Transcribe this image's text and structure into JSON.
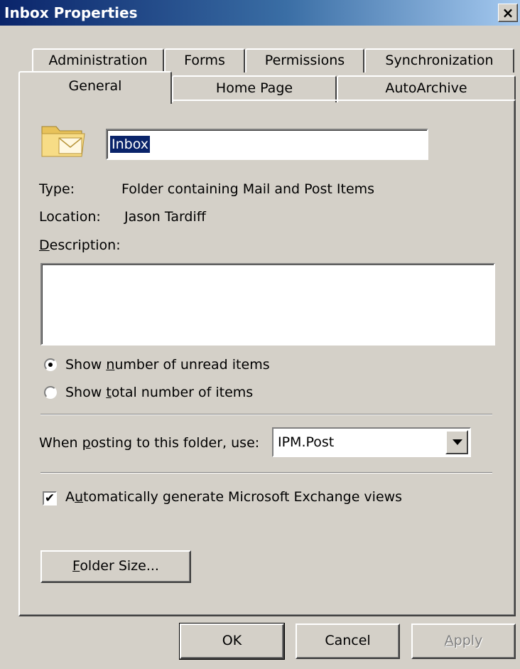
{
  "window": {
    "title": "Inbox Properties",
    "close_glyph": "×"
  },
  "tabs": {
    "back_row": [
      "Administration",
      "Forms",
      "Permissions",
      "Synchronization"
    ],
    "front_row": [
      "General",
      "Home Page",
      "AutoArchive"
    ],
    "selected": "General"
  },
  "general": {
    "folder_icon": "mail-folder-icon",
    "name_value": "Inbox",
    "type_label": "Type:",
    "type_value": "Folder containing Mail and Post Items",
    "location_label": "Location:",
    "location_value": "Jason Tardiff",
    "description_label": {
      "pre": "",
      "key": "D",
      "post": "escription:"
    },
    "description_value": "",
    "radio_unread": {
      "pre": "Show ",
      "key": "n",
      "post": "umber of unread items",
      "checked": true
    },
    "radio_total": {
      "pre": "Show ",
      "key": "t",
      "post": "otal number of items",
      "checked": false
    },
    "posting_label": {
      "pre": "When ",
      "key": "p",
      "post": "osting to this folder, use:"
    },
    "posting_value": "IPM.Post",
    "auto_views": {
      "pre": "A",
      "key": "u",
      "post": "tomatically generate Microsoft Exchange views",
      "checked": true,
      "glyph": "✔"
    },
    "folder_size_button": {
      "pre": "",
      "key": "F",
      "post": "older Size..."
    }
  },
  "buttons": {
    "ok": "OK",
    "cancel": "Cancel",
    "apply": {
      "pre": "",
      "key": "A",
      "post": "pply",
      "disabled": true
    }
  }
}
